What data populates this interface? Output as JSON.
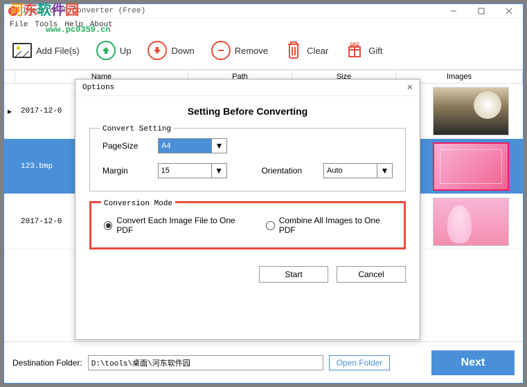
{
  "window": {
    "title": "ImagetoPDF Converter (Free)"
  },
  "menu": {
    "file": "File",
    "tools": "Tools",
    "help": "Help",
    "about": "About"
  },
  "watermark": {
    "text": "河东软件园",
    "url": "www.pc0359.cn"
  },
  "toolbar": {
    "addfiles": "Add File(s)",
    "up": "Up",
    "down": "Down",
    "remove": "Remove",
    "clear": "Clear",
    "gift": "Gift"
  },
  "table": {
    "headers": {
      "name": "Name",
      "path": "Path",
      "size": "Size",
      "images": "Images"
    },
    "rows": [
      {
        "name": "2017-12-0"
      },
      {
        "name": "123.bmp"
      },
      {
        "name": "2017-12-0"
      }
    ]
  },
  "footer": {
    "dest_label": "Destination Folder:",
    "dest_value": "D:\\tools\\桌面\\河东软件园",
    "open_folder": "Open Folder",
    "next": "Next"
  },
  "dialog": {
    "title": "Options",
    "heading": "Setting Before Converting",
    "convert_setting_legend": "Convert Setting",
    "pagesize_label": "PageSize",
    "pagesize_value": "A4",
    "margin_label": "Margin",
    "margin_value": "15",
    "orientation_label": "Orientation",
    "orientation_value": "Auto",
    "mode_legend": "Conversion Mode",
    "mode_each": "Convert Each Image File to One PDF",
    "mode_combine": "Combine All Images to One PDF",
    "start": "Start",
    "cancel": "Cancel"
  },
  "colors": {
    "accent": "#4a90d9",
    "up": "#27ae60",
    "down": "#e74c3c",
    "gift": "#e74c3c",
    "trash": "#e74c3c"
  }
}
